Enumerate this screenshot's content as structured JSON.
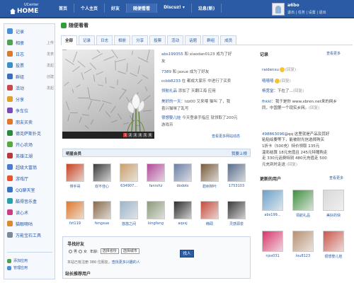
{
  "logo": {
    "top": "UCenter",
    "home": "HOME"
  },
  "nav": [
    "首页",
    "个人主页",
    "好友",
    "随便看看",
    "Discuz! ▾",
    "沿息(新)"
  ],
  "user": {
    "name": "a6bo",
    "links": "退出 | 任务 | 设置 | 退出"
  },
  "sidebar": {
    "items": [
      {
        "label": "记录",
        "extra": "",
        "color": "#4a90d9"
      },
      {
        "label": "相册",
        "extra": "上传",
        "color": "#4fa24f"
      },
      {
        "label": "日志",
        "extra": "发表",
        "color": "#d77b2f"
      },
      {
        "label": "投票",
        "extra": "发起",
        "color": "#3b8fc9"
      },
      {
        "label": "群组",
        "extra": "创建",
        "color": "#3c6dbf"
      },
      {
        "label": "活动",
        "extra": "发起",
        "color": "#c94a4a"
      },
      {
        "label": "分享",
        "extra": "",
        "color": "#e0a02b"
      },
      {
        "label": "争车位",
        "extra": "",
        "color": "#7b4ab4"
      },
      {
        "label": "朋友买卖",
        "extra": "",
        "color": "#e2762a"
      },
      {
        "label": "德克萨斯扑克",
        "extra": "",
        "color": "#2d8a3c"
      },
      {
        "label": "开心农场",
        "extra": "",
        "color": "#58a841"
      },
      {
        "label": "英雄江湖",
        "extra": "",
        "color": "#b53b3b"
      },
      {
        "label": "超级大富翁",
        "extra": "",
        "color": "#4a7bd0"
      },
      {
        "label": "游戏厅",
        "extra": "",
        "color": "#e8542c"
      },
      {
        "label": "QQ聊天室",
        "extra": "",
        "color": "#3a75c4"
      },
      {
        "label": "酷得音乐盒",
        "extra": "",
        "color": "#2aa0a8"
      },
      {
        "label": "读心术",
        "extra": "",
        "color": "#cc3d88"
      },
      {
        "label": "猫眼嘀咕",
        "extra": "",
        "color": "#d98932"
      },
      {
        "label": "万能宝石工具",
        "extra": "",
        "color": "#7b8a99"
      }
    ],
    "footer": [
      {
        "label": "添加应用",
        "color": "#4fa24f"
      },
      {
        "label": "管理应用",
        "color": "#4a90d9"
      }
    ]
  },
  "title": "随便看看",
  "tabs": [
    "全部",
    "记录",
    "日志",
    "相册",
    "分享",
    "投票",
    "活动",
    "话题",
    "群组",
    "成员"
  ],
  "feed": [
    {
      "user": "abs199355",
      "text": " 和 xiaodan0123 成为了好",
      "line2": "友"
    },
    {
      "user": "7389",
      "text": " 和 jaxue 成为了好友",
      "line2": ""
    },
    {
      "user": "ccbb8233",
      "text": " 在 都成大家乐 中进行了买卖",
      "line2": ""
    },
    {
      "user": "领航礼品",
      "text": " 添加了 天翻江海 应用",
      "line2": ""
    },
    {
      "user": "美好的一天",
      "text": "：ldz00 又来喂 猫叫 了，我",
      "line2": "喜兴猫咪了乱写"
    },
    {
      "user": "很想娶儿娃",
      "text": " 今天登录手指应 就领取了200元",
      "line2": "游戏币"
    }
  ],
  "more_activity": "查看更多网站动态",
  "stars": {
    "header": "明星会员",
    "link": "我要上榜",
    "members": [
      {
        "name": "俳手哥",
        "color": "#c8421f"
      },
      {
        "name": "双不佳心",
        "color": "#3a3a3a"
      },
      {
        "name": "634907...",
        "color": "#c9a06b"
      },
      {
        "name": "fanrxhz",
        "color": "#b24a99"
      },
      {
        "name": "dodots",
        "color": "#6b7fa5"
      },
      {
        "name": "碧树林叶",
        "color": "#7a5a3a"
      },
      {
        "name": "1753103",
        "color": "#5a6d8a"
      },
      {
        "name": "fzt119",
        "color": "#e0782a"
      },
      {
        "name": "fengxue",
        "color": "#8a6a4a"
      },
      {
        "name": "悠悠之间",
        "color": "#9ab4c8"
      },
      {
        "name": "kingfang",
        "color": "#8c9a7a"
      },
      {
        "name": "aqxsj",
        "color": "#2d2d2d"
      },
      {
        "name": "韩硕",
        "color": "#c84a3a"
      },
      {
        "name": "灵感源泉",
        "color": "#3a3a3a"
      }
    ]
  },
  "find": {
    "title": "寻找好友",
    "gender": [
      "男",
      "女"
    ],
    "age_label": "年龄:",
    "age_value": "选择省份",
    "city_value": "选择城市",
    "button": "找人",
    "note_prefix": "本站已有注册 380 位朋友，",
    "note_link": "查找更多兴趣的人",
    "station": "站长推荐用户"
  },
  "records": {
    "header": "记录",
    "more": "查看更多",
    "items": [
      {
        "user": "raidensu",
        "text": "",
        "emoji": true,
        "tail": "(回复)"
      },
      {
        "user": "嘻嘻嘻",
        "text": "",
        "emoji": true,
        "tail": "(回复)"
      },
      {
        "user": "杨宽堂",
        "text": "：下在了...",
        "emoji": false,
        "tail": "(回复)"
      },
      {
        "user": "fhkkl",
        "text": "：我于是你 www.xbren.net来的网乡",
        "emoji": false,
        "tail": ""
      },
      {
        "user": "",
        "text": "同，中国第一个现实乡网。",
        "emoji": false,
        "tail": "(回复)"
      },
      {
        "user": "498863096",
        "text": "@qq 这里就是产品及其好",
        "emoji": false,
        "tail": ""
      },
      {
        "user": "",
        "text": "粘贴绘要等下，能被耐光信选择购买",
        "emoji": false,
        "tail": ""
      },
      {
        "user": "",
        "text": "1折卡（500充）特价领取 135元",
        "emoji": false,
        "tail": ""
      },
      {
        "user": "",
        "text": "温彩结算 18元充值且 245元特赠购走",
        "emoji": false,
        "tail": ""
      },
      {
        "user": "",
        "text": "走 330元话费特别 480元充值走 500",
        "emoji": false,
        "tail": ""
      },
      {
        "user": "",
        "text": "元充到时走送  ",
        "emoji": false,
        "tail": "(回复)"
      }
    ]
  },
  "updates": {
    "header": "更新的用户",
    "more": "查看更多",
    "users": [
      {
        "name": "abs199...",
        "color": "#6aa0c9"
      },
      {
        "name": "领航礼品",
        "color": "#3f8f3f"
      },
      {
        "name": "美好的快",
        "color": "#d8d8d8"
      },
      {
        "name": "njss031",
        "color": "#d8356a"
      },
      {
        "name": "lou8123",
        "color": "#b89070"
      },
      {
        "name": "很想娶儿娃",
        "color": "#c9564a"
      }
    ]
  }
}
